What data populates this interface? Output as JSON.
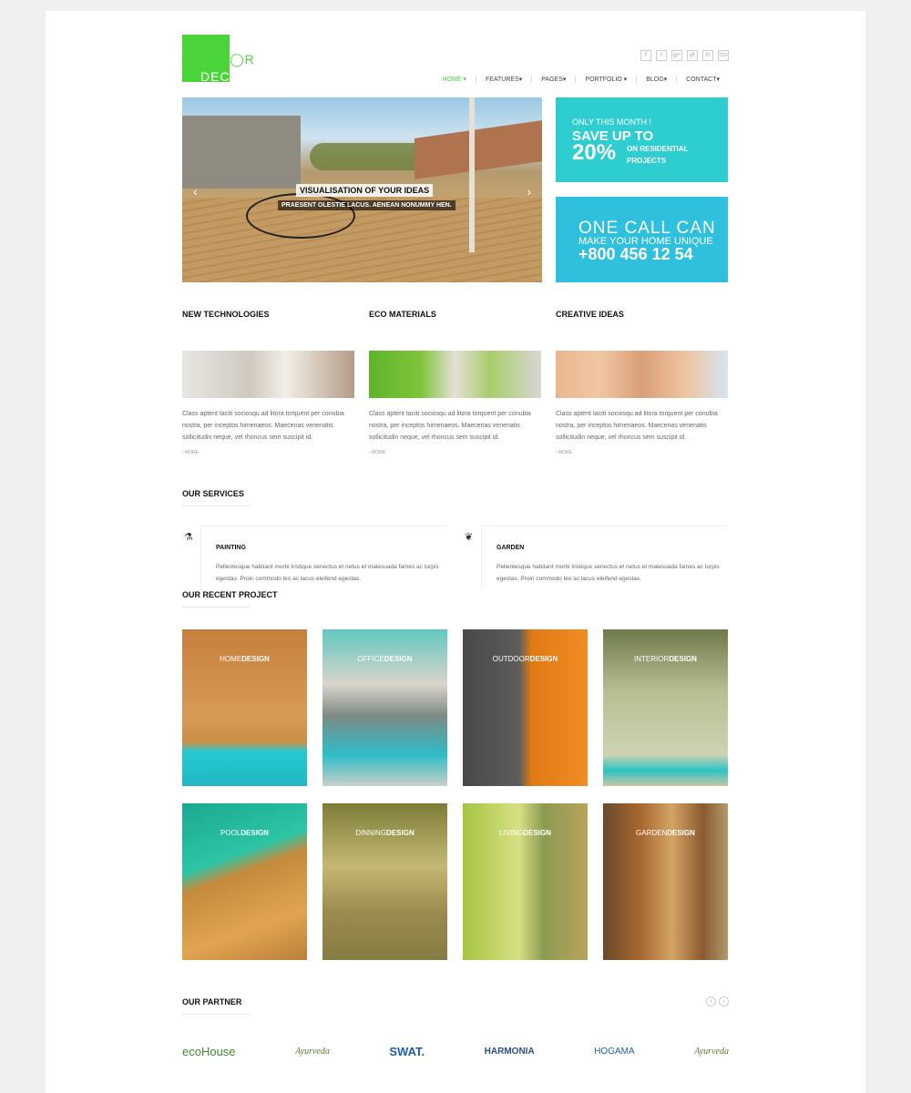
{
  "brand": {
    "name_a": "DEC",
    "name_b": "R",
    "color": "#4bd43a"
  },
  "social": [
    "f",
    "t",
    "g+",
    "yt",
    "in",
    "rss"
  ],
  "nav": [
    {
      "label": "HOME",
      "active": true
    },
    {
      "label": "FEATURES"
    },
    {
      "label": "PAGES"
    },
    {
      "label": "PORTFOLIO"
    },
    {
      "label": "BLOG"
    },
    {
      "label": "CONTACT"
    }
  ],
  "hero": {
    "caption_title": "VISUALISATION OF YOUR IDEAS",
    "caption_sub": "PRAESENT OLESTIE LACUS. AENEAN NONUMMY HEN."
  },
  "promo1": {
    "line1": "ONLY THIS MONTH !",
    "line2": "SAVE UP TO",
    "percent": "20%",
    "line3": "ON RESIDENTIAL PROJECTS"
  },
  "promo2": {
    "line1": "ONE CALL CAN",
    "line2": "MAKE YOUR HOME UNIQUE",
    "phone": "+800 456 12 54"
  },
  "features": [
    {
      "title": "NEW TECHNOLOGIES",
      "text": "Class aptent taciti sociosqu ad litora torquent per conubia nostra, per inceptos himenaeos. Maecenas venenatis sollicitudin neque, vel rhoncus sem suscipit id.",
      "more": "› MORE"
    },
    {
      "title": "ECO MATERIALS",
      "text": "Class aptent taciti sociosqu ad litora torquent per conubia nostra, per inceptos himenaeos. Maecenas venenatis sollicitudin neque, vel rhoncus sem suscipit id.",
      "more": "› MORE"
    },
    {
      "title": "CREATIVE IDEAS",
      "text": "Class aptent taciti sociosqu ad litora torquent per conubia nostra, per inceptos himenaeos. Maecenas venenatis sollicitudin neque, vel rhoncus sem suscipit id.",
      "more": "› MORE"
    }
  ],
  "services_title": "OUR SERVICES",
  "services": [
    {
      "title": "PAINTING",
      "icon": "flask-icon",
      "text": "Pellentesque habitant morbi tristique senectus et netus et malesuada fames ac turpis egestas. Proin commodo leo ac lacus eleifend egestas."
    },
    {
      "title": "GARDEN",
      "icon": "leaf-icon",
      "text": "Pellentesque habitant morbi tristique senectus et netus et malesuada fames ac turpis egestas. Proin commodo leo ac lacus eleifend egestas."
    }
  ],
  "projects_title": "OUR RECENT PROJECT",
  "projects": [
    {
      "a": "HOME",
      "b": "DESIGN"
    },
    {
      "a": "OFFICE",
      "b": "DESIGN"
    },
    {
      "a": "OUTDOOR",
      "b": "DESIGN"
    },
    {
      "a": "INTERIOR",
      "b": "DESIGN"
    },
    {
      "a": "POOL",
      "b": "DESIGN"
    },
    {
      "a": "DINNING",
      "b": "DESIGN"
    },
    {
      "a": "LIVING",
      "b": "DESIGN"
    },
    {
      "a": "GARDEN",
      "b": "DESIGN"
    }
  ],
  "partners_title": "OUR PARTNER",
  "partners": [
    "ecoHouse",
    "Ayurveda",
    "SWAT.",
    "HARMONIA",
    "HOGAMA",
    "Ayurveda"
  ]
}
